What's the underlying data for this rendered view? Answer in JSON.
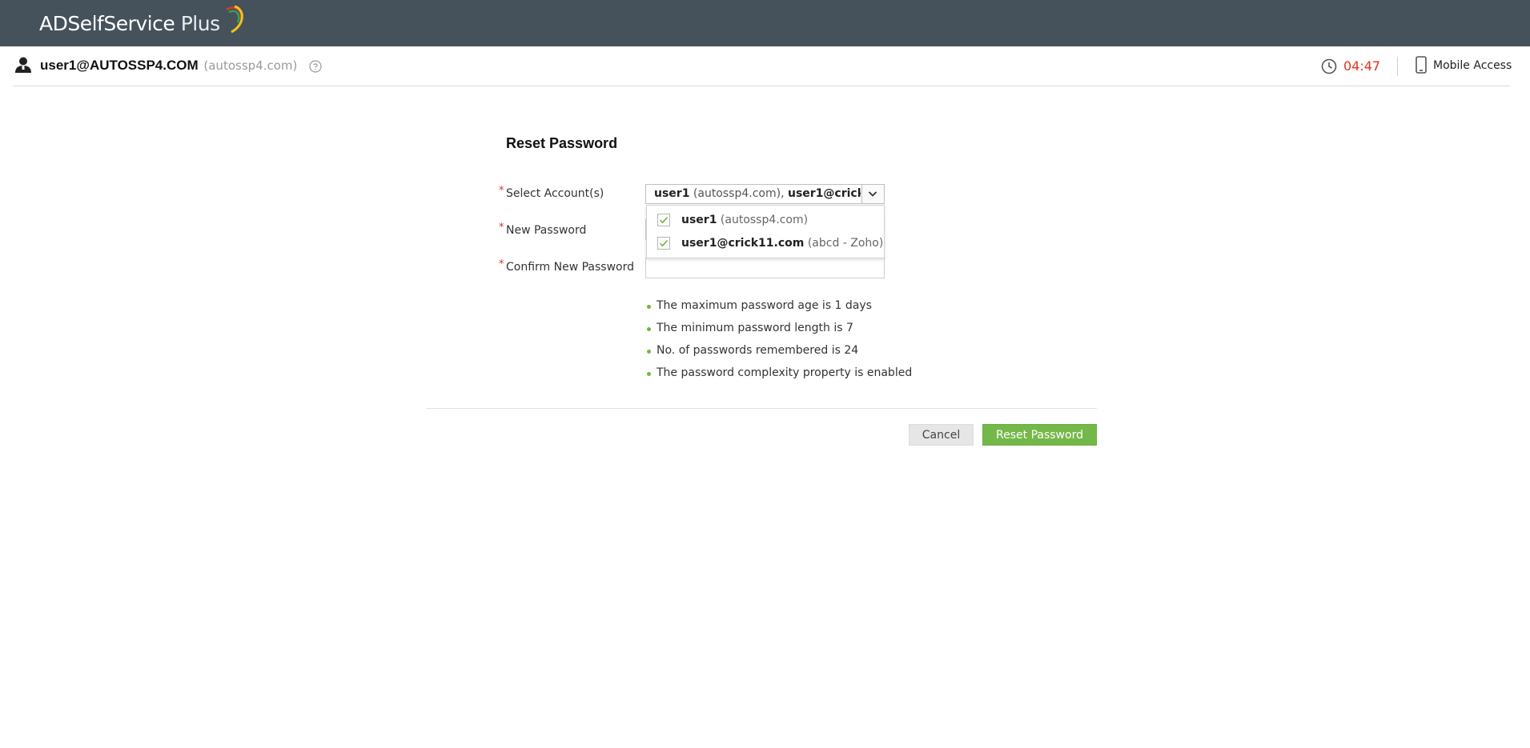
{
  "header": {
    "logo_text": "ADSelfService",
    "logo_plus": "Plus"
  },
  "userbar": {
    "username": "user1@AUTOSSP4.COM",
    "domain": "(autossp4.com)",
    "timer": "04:47",
    "mobile_access": "Mobile Access",
    "icons": [
      "user-icon",
      "help-icon",
      "clock-icon",
      "mobile-icon"
    ]
  },
  "form": {
    "title": "Reset Password",
    "required_marker": "*",
    "select_accounts": {
      "label": "Select Account(s)",
      "value_parts": [
        {
          "name": "user1",
          "detail": "(autossp4.com),"
        },
        {
          "name": "user1@crick11.com",
          "detail": ""
        }
      ],
      "options": [
        {
          "name": "user1",
          "detail": "(autossp4.com)",
          "checked": true
        },
        {
          "name": "user1@crick11.com",
          "detail": "(abcd - Zoho)",
          "checked": true
        }
      ]
    },
    "new_password": {
      "label": "New Password",
      "value": ""
    },
    "confirm_password": {
      "label": "Confirm New Password",
      "value": ""
    },
    "policy_rules": [
      "The maximum password age is 1 days",
      "The minimum password length is 7",
      "No. of passwords remembered is 24",
      "The password complexity property is enabled"
    ],
    "buttons": {
      "cancel": "Cancel",
      "reset": "Reset Password"
    }
  },
  "colors": {
    "topbar": "#45525b",
    "accent_green": "#75b84a",
    "timer_red": "#e0321f"
  }
}
